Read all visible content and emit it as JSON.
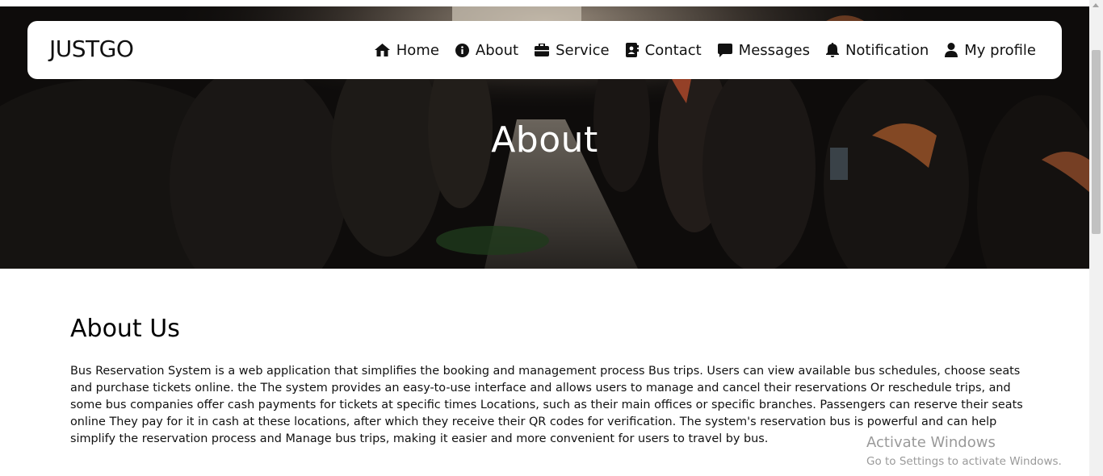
{
  "navbar": {
    "brand": "JUSTGO",
    "items": [
      {
        "label": "Home",
        "icon": "home-icon"
      },
      {
        "label": "About",
        "icon": "info-circle-icon"
      },
      {
        "label": "Service",
        "icon": "briefcase-icon"
      },
      {
        "label": "Contact",
        "icon": "contact-card-icon"
      },
      {
        "label": "Messages",
        "icon": "message-icon"
      },
      {
        "label": "Notification",
        "icon": "bell-icon"
      },
      {
        "label": "My profile",
        "icon": "user-icon"
      }
    ]
  },
  "hero": {
    "title": "About"
  },
  "about": {
    "heading": "About Us",
    "body": "Bus Reservation System is a web application that simplifies the booking and management process Bus trips. Users can view available bus schedules, choose seats and purchase tickets online. the The system provides an easy-to-use interface and allows users to manage and cancel their reservations Or reschedule trips, and some bus companies offer cash payments for tickets at specific times Locations, such as their main offices or specific branches. Passengers can reserve their seats online They pay for it in cash at these locations, after which they receive their QR codes for verification. The system's reservation bus is powerful and can help simplify the reservation process and Manage bus trips, making it easier and more convenient for users to travel by bus."
  },
  "watermark": {
    "title": "Activate Windows",
    "subtitle": "Go to Settings to activate Windows."
  },
  "colors": {
    "hero_dark": "#0e0c0b",
    "navbar_bg": "#ffffff",
    "text": "#111111",
    "watermark": "#9a9a9a"
  }
}
